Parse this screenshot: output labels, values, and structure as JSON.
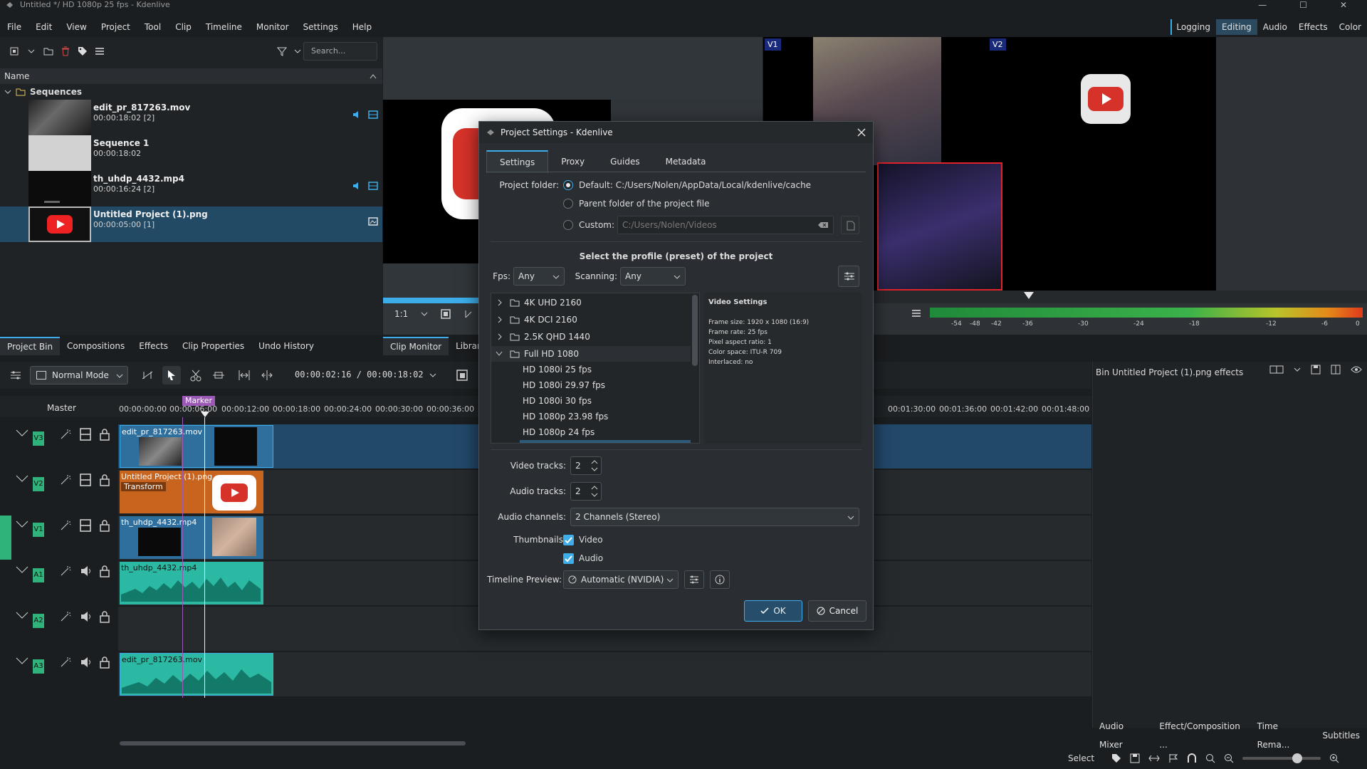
{
  "window": {
    "title": "Untitled */ HD 1080p 25 fps - Kdenlive"
  },
  "menu": [
    "File",
    "Edit",
    "View",
    "Project",
    "Tool",
    "Clip",
    "Timeline",
    "Monitor",
    "Settings",
    "Help"
  ],
  "workspaces": [
    "Logging",
    "Editing",
    "Audio",
    "Effects",
    "Color"
  ],
  "bin": {
    "search_placeholder": "Search...",
    "column_name": "Name",
    "folder": "Sequences",
    "items": [
      {
        "name": "edit_pr_817263.mov",
        "duration": "00:00:18:02 [2]"
      },
      {
        "name": "Sequence 1",
        "duration": "00:00:18:02"
      },
      {
        "name": "th_uhdp_4432.mp4",
        "duration": "00:00:16:24 [2]"
      },
      {
        "name": "Untitled Project (1).png",
        "duration": "00:00:05:00 [1]"
      }
    ]
  },
  "left_tabs": [
    "Project Bin",
    "Compositions",
    "Effects",
    "Clip Properties",
    "Undo History"
  ],
  "monitor_tabs": [
    "Clip Monitor",
    "Librar"
  ],
  "monitor": {
    "zoom": "1:1",
    "v1": "V1",
    "v2": "V2"
  },
  "audio_meter_ticks": [
    "-54",
    "-48",
    "-42",
    "-36",
    "-30",
    "-24",
    "-18",
    "-12",
    "-6",
    "0"
  ],
  "timeline": {
    "mode": "Normal Mode",
    "timecode": "00:00:02:16 / 00:00:18:02",
    "master": "Master",
    "marker": "Marker",
    "ruler": [
      "00:00:00:00",
      "00:00:06:00",
      "00:00:12:00",
      "00:00:18:00",
      "00:00:24:00",
      "00:00:30:00",
      "00:00:36:00",
      "00:01:30:00",
      "00:01:36:00",
      "00:01:42:00",
      "00:01:48:00"
    ],
    "tracks": [
      "V3",
      "V2",
      "V1",
      "A1",
      "A2",
      "A3"
    ],
    "clips": {
      "v3": "edit_pr_817263.mov",
      "v2": "Untitled Project (1).png",
      "v2_effect": "Transform",
      "v1": "th_uhdp_4432.mp4",
      "a1": "th_uhdp_4432.mp4",
      "a3": "edit_pr_817263.mov"
    }
  },
  "effects_panel": {
    "title": "Bin Untitled Project (1).png effects"
  },
  "bottom_right_tabs": [
    "Audio Mixer",
    "Effect/Composition ...",
    "Time Rema...",
    "Subtitles"
  ],
  "statusbar": {
    "select": "Select"
  },
  "dialog": {
    "title": "Project Settings - Kdenlive",
    "tabs": [
      "Settings",
      "Proxy",
      "Guides",
      "Metadata"
    ],
    "project_folder_label": "Project folder:",
    "opt_default": "Default: C:/Users/Nolen/AppData/Local/kdenlive/cache",
    "opt_parent": "Parent folder of the project file",
    "opt_custom": "Custom:",
    "custom_placeholder": "C:/Users/Nolen/Videos",
    "profile_heading": "Select the profile (preset) of the project",
    "fps_label": "Fps:",
    "fps_value": "Any",
    "scanning_label": "Scanning:",
    "scanning_value": "Any",
    "profile_groups": [
      "4K UHD 2160",
      "4K DCI 2160",
      "2.5K QHD 1440",
      "Full HD 1080"
    ],
    "profile_items": [
      "HD 1080i 25 fps",
      "HD 1080i 29.97 fps",
      "HD 1080i 30 fps",
      "HD 1080p 23.98 fps",
      "HD 1080p 24 fps"
    ],
    "video_settings": {
      "title": "Video Settings",
      "lines": [
        "Frame size: 1920 x 1080 (16:9)",
        "Frame rate: 25 fps",
        "Pixel aspect ratio: 1",
        "Color space: ITU-R 709",
        "Interlaced: no"
      ]
    },
    "video_tracks_label": "Video tracks:",
    "video_tracks": "2",
    "audio_tracks_label": "Audio tracks:",
    "audio_tracks": "2",
    "audio_channels_label": "Audio channels:",
    "audio_channels": "2 Channels (Stereo)",
    "thumbnails_label": "Thumbnails:",
    "thumb_video": "Video",
    "thumb_audio": "Audio",
    "timeline_preview_label": "Timeline Preview:",
    "timeline_preview": "Automatic (NVIDIA)",
    "ok": "OK",
    "cancel": "Cancel"
  },
  "colors": {
    "accent": "#3daee9",
    "track_green": "#2fb37a",
    "audio_clip": "#2bb9a3",
    "image_clip": "#c8641e",
    "video_clip": "#2f6f9e"
  }
}
